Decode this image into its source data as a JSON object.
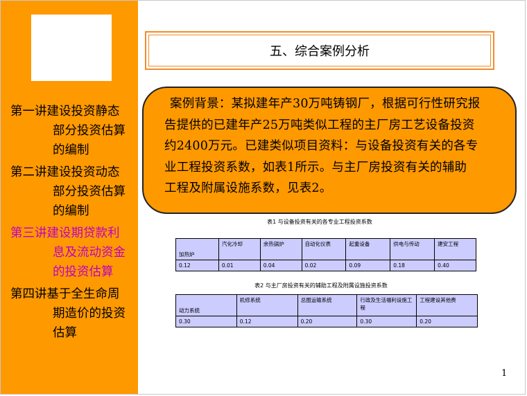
{
  "sidebar": {
    "items": [
      {
        "lines": [
          "第一讲建设投资静态",
          "部分投资估算",
          "的编制"
        ],
        "active": false
      },
      {
        "lines": [
          "第二讲建设投资动态",
          "部分投资估算",
          "的编制"
        ],
        "active": false
      },
      {
        "lines": [
          "第三讲建设期贷款利",
          "息及流动资金",
          "的投资估算"
        ],
        "active": true
      },
      {
        "lines": [
          "第四讲基于全生命周",
          "期造价的投资",
          "估算"
        ],
        "active": false
      }
    ]
  },
  "title": "五、综合案例分析",
  "background": {
    "lines": [
      "案例背景：某拟建年产30万吨铸钢厂，根据可行性研究报",
      "告提供的已建年产25万吨类似工程的主厂房工艺设备投资",
      "约2400万元。已建类似项目资料：与设备投资有关的各专",
      "业工程投资系数，如表1所示。与主厂房投资有关的辅助",
      "工程及附属设施系数，见表2。"
    ]
  },
  "table1": {
    "caption": "表1 与设备投资有关的各专业工程投资系数",
    "headers": [
      "加热炉",
      "汽化冷却",
      "余热锅炉",
      "自动化仪表",
      "起重设备",
      "供电与传动",
      "建安工程"
    ],
    "values": [
      "0.12",
      "0.01",
      "0.04",
      "0.02",
      "0.09",
      "0.18",
      "0.40"
    ]
  },
  "table2": {
    "caption": "表2 与主厂房投资有关的辅助工程及附属设施投资系数",
    "headers": [
      "动力系统",
      "机修系统",
      "总图运输系统",
      "行政及生活福利设施工程",
      "工程建设其他费"
    ],
    "values": [
      "0.30",
      "0.12",
      "0.20",
      "0.30",
      "0.20"
    ]
  },
  "page_number": "1",
  "colors": {
    "sidebar": "#ff9900",
    "callout": "#ff9900",
    "active_nav": "#c000c0",
    "table_fill": "#ccccff",
    "title_border": "#f28c28"
  }
}
